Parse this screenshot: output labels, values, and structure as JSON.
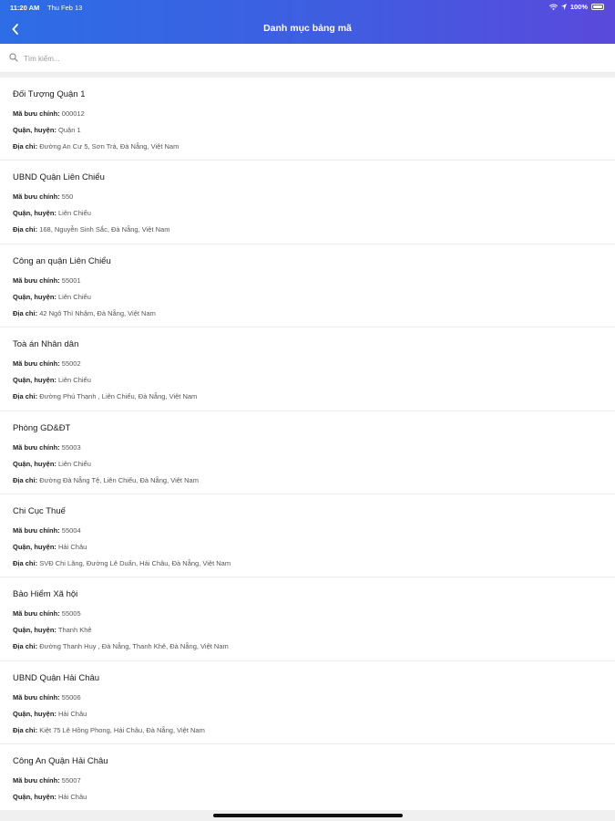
{
  "status_bar": {
    "time": "11:20 AM",
    "date": "Thu Feb 13",
    "battery": "100%"
  },
  "header": {
    "title": "Danh mục bảng mã"
  },
  "search": {
    "placeholder": "Tìm kiếm..."
  },
  "labels": {
    "postal_code": "Mã bưu chính:",
    "district": "Quận, huyện:",
    "address": "Địa chỉ:"
  },
  "items": [
    {
      "name": "Đối Tượng Quận 1",
      "postal_code": "000012",
      "district": "Quận 1",
      "address": "Đường An Cư 5, Sơn Trà, Đà Nẵng, Việt Nam"
    },
    {
      "name": "UBND Quận Liên Chiểu",
      "postal_code": "550",
      "district": "Liên Chiểu",
      "address": "168, Nguyễn Sinh Sắc, Đà Nẵng, Việt Nam"
    },
    {
      "name": "Công an quận Liên Chiểu",
      "postal_code": "55001",
      "district": "Liên Chiểu",
      "address": "42 Ngô Thì Nhậm, Đà Nẵng, Việt Nam"
    },
    {
      "name": "Toà án Nhân dân",
      "postal_code": "55002",
      "district": "Liên Chiểu",
      "address": "Đường Phú Thạnh , Liên Chiểu, Đà Nẵng, Việt Nam"
    },
    {
      "name": "Phòng GD&ĐT",
      "postal_code": "55003",
      "district": "Liên Chiểu",
      "address": "Đường Đà Nẵng Tệ, Liên Chiểu, Đà Nẵng, Việt Nam"
    },
    {
      "name": "Chi Cục Thuế",
      "postal_code": "55004",
      "district": "Hải Châu",
      "address": "SVĐ Chi Lăng, Đường Lê Duẩn, Hải Châu, Đà Nẵng, Việt Nam"
    },
    {
      "name": "Bảo Hiểm Xã hội",
      "postal_code": "55005",
      "district": "Thanh Khê",
      "address": "Đường Thanh Huy , Đà Nẵng, Thanh Khê, Đà Nẵng, Việt Nam"
    },
    {
      "name": "UBND Quận Hải Châu",
      "postal_code": "55006",
      "district": "Hải Châu",
      "address": "Kiệt 75 Lê Hồng Phong, Hải Châu, Đà Nẵng, Việt Nam"
    },
    {
      "name": "Công An Quận Hải Châu",
      "postal_code": "55007",
      "district": "Hải Châu",
      "address": ""
    }
  ]
}
